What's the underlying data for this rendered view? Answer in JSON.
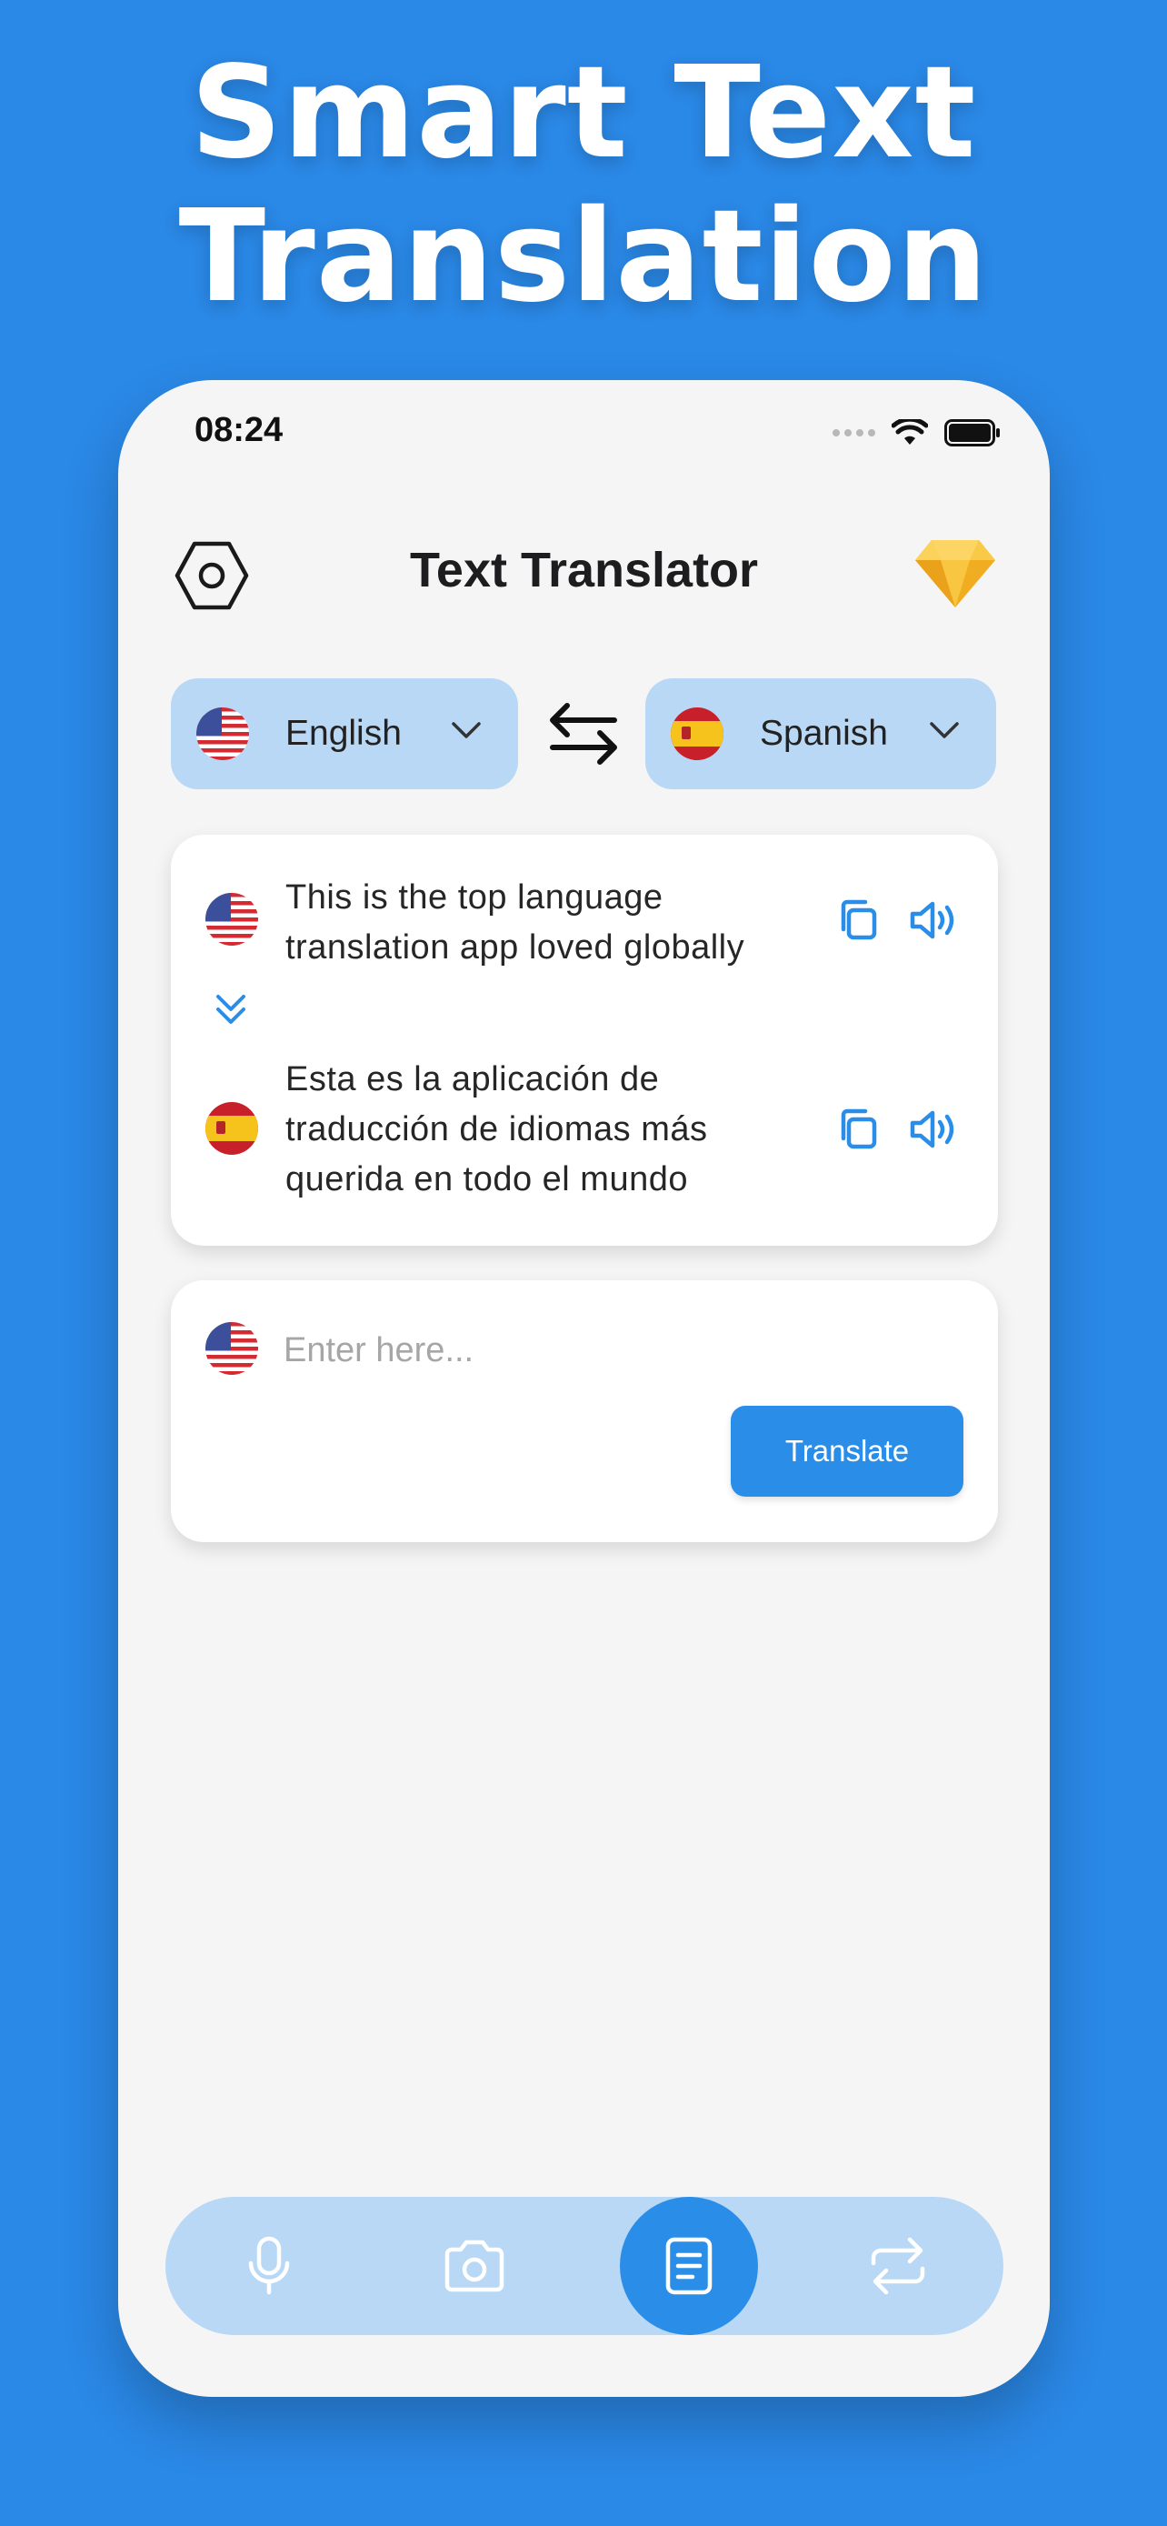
{
  "promo": {
    "title_line1": "Smart Text",
    "title_line2": "Translation"
  },
  "status_bar": {
    "time": "08:24"
  },
  "header": {
    "title": "Text Translator",
    "settings_icon": "hexagon-settings-icon",
    "premium_icon": "diamond-icon"
  },
  "languages": {
    "source": {
      "name": "English",
      "flag": "us-flag"
    },
    "target": {
      "name": "Spanish",
      "flag": "spain-flag"
    }
  },
  "result": {
    "source_text": "This is the top language translation app loved globally",
    "target_text": "Esta es la aplicación de traducción de idiomas más querida en todo el mundo"
  },
  "input": {
    "placeholder": "Enter here...",
    "translate_label": "Translate"
  },
  "bottom_nav": {
    "items": [
      "microphone",
      "camera",
      "text",
      "conversation"
    ],
    "active": "text"
  },
  "colors": {
    "background": "#2a88e6",
    "accent": "#2a8ee8",
    "pill": "#b9d8f6",
    "premium": "#f5b82e"
  }
}
